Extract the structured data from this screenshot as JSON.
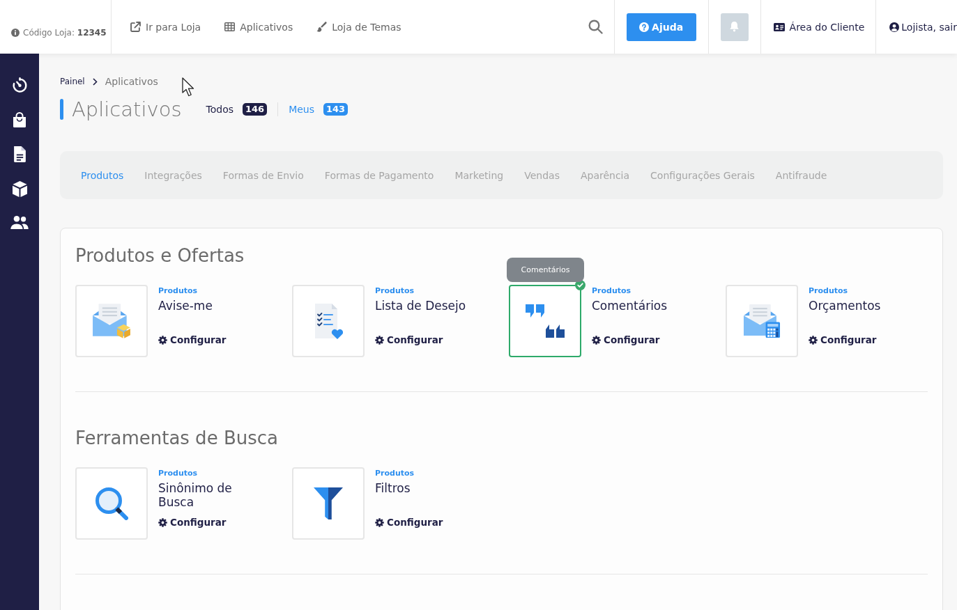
{
  "top_bar": {
    "store_code": "Código Loja: **12345**",
    "links": [
      "Ir para Loja",
      "Aplicativos",
      "Loja de Temas"
    ],
    "help_button": "Ajuda",
    "client_area": "Área do Cliente",
    "logout": "Lojista, sair"
  },
  "breadcrumb": [
    "Painel",
    "Aplicativos"
  ],
  "page": {
    "title": "Aplicativos",
    "filters": [
      {
        "label": "Todos",
        "count": "146",
        "selected": true
      },
      {
        "label": "Meus",
        "count": "143",
        "selected": false
      }
    ]
  },
  "tabs": [
    {
      "label": "Produtos",
      "selected": true
    },
    {
      "label": "Integrações",
      "selected": false
    },
    {
      "label": "Formas de Envio",
      "selected": false
    },
    {
      "label": "Formas de Pagamento",
      "selected": false
    },
    {
      "label": "Marketing",
      "selected": false
    },
    {
      "label": "Vendas",
      "selected": false
    },
    {
      "label": "Aparência",
      "selected": false
    },
    {
      "label": "Configurações Gerais",
      "selected": false
    },
    {
      "label": "Antifraude",
      "selected": false
    }
  ],
  "sections": [
    {
      "title": "Produtos e Ofertas",
      "apps": [
        {
          "category": "Produtos",
          "name": "Avise-me",
          "action": "Configurar",
          "selected": false
        },
        {
          "category": "Produtos",
          "name": "Lista de Desejo",
          "action": "Configurar",
          "selected": false
        },
        {
          "category": "Produtos",
          "name": "Comentários",
          "action": "Configurar",
          "selected": true,
          "tooltip": "Comentários"
        },
        {
          "category": "Produtos",
          "name": "Orçamentos",
          "action": "Configurar",
          "selected": false
        }
      ]
    },
    {
      "title": "Ferramentas de Busca",
      "apps": [
        {
          "category": "Produtos",
          "name": "Sinônimo de Busca",
          "action": "Configurar",
          "selected": false
        },
        {
          "category": "Produtos",
          "name": "Filtros",
          "action": "Configurar",
          "selected": false
        }
      ]
    }
  ]
}
